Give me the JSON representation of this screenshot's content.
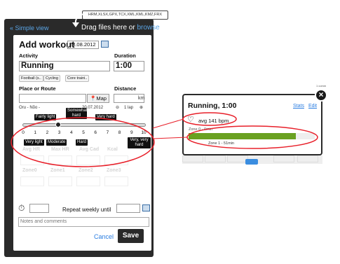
{
  "header": {
    "simple_view": "« Simple view",
    "drag_text": "Drag files here or ",
    "browse": "browse",
    "formats": "HRM,XLSX,GPX,TCX,XML,KML,KMZ,FRX"
  },
  "form": {
    "title": "Add workout",
    "date": "23.08.2012",
    "activity_label": "Activity",
    "duration_label": "Duration",
    "activity_value": "Running",
    "duration_value": "1:00",
    "chips": [
      "Football (s..",
      "Cycling",
      "Core traini.."
    ],
    "place_label": "Place or Route",
    "distance_label": "Distance",
    "map_button": "Map",
    "distance_unit": "km",
    "route_info": "Oru - Nõo -",
    "route_date": "20.07.2012",
    "lap_info": "1 lap",
    "rpe_numbers": [
      "0",
      "1",
      "2",
      "3",
      "4",
      "5",
      "6",
      "7",
      "8",
      "9",
      "10"
    ],
    "rpe_top_labels": [
      "Fairly light",
      "Somewhat hard",
      "Very hard"
    ],
    "rpe_bottom_labels": [
      "Very light",
      "Moderate",
      "Hard",
      "Very, very hard"
    ],
    "faded_row1": [
      "Avg HR",
      "Max HR",
      "Avg Cad",
      "Kcal"
    ],
    "faded_row2": [
      "Zone0",
      "Zone1",
      "Zone2",
      "Zone3"
    ],
    "repeat_label": "Repeat weekly until",
    "notes_placeholder": "Notes and comments",
    "cancel": "Cancel",
    "save": "Save"
  },
  "popup": {
    "title": "Running, 1:00",
    "stats_link": "Stats",
    "edit_link": "Edit",
    "avg_hr": "avg 141 bpm",
    "zone0": "Zone 0 - 0min",
    "zone1": "Zone 1 - 51min",
    "zone_bar_fraction": 0.85,
    "zone_bar_color": "#6aa121",
    "corner_text": "1 comm"
  },
  "colors": {
    "annotation": "#e8202a",
    "link": "#2a7de1"
  }
}
